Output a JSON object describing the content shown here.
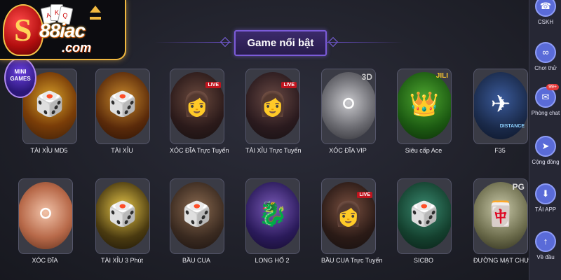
{
  "logo": {
    "brand": "88iac",
    "domain": ".com"
  },
  "mini_games_badge": "MINI GAMES",
  "section": {
    "title": "Game nổi bật"
  },
  "games_row1": [
    {
      "label": "TÀI XỈU MD5",
      "icon": "golden-dice-cup-icon"
    },
    {
      "label": "TÀI XỈU",
      "icon": "dice-icon"
    },
    {
      "label": "XÓC ĐĨA Trực Tuyến",
      "icon": "live-dealer-icon",
      "badge": "LIVE"
    },
    {
      "label": "TÀI XỈU Trực Tuyến",
      "icon": "live-dealer-icon",
      "badge": "LIVE"
    },
    {
      "label": "XÓC ĐĨA VIP",
      "icon": "bowl-plate-icon",
      "badge": "3D"
    },
    {
      "label": "Siêu cấp Ace",
      "icon": "jester-crown-icon",
      "badge": "JILI"
    },
    {
      "label": "F35",
      "icon": "fighter-jet-icon",
      "badge": "DISTANCE"
    }
  ],
  "games_row2": [
    {
      "label": "XÓC ĐĨA",
      "icon": "bowl-plate-icon"
    },
    {
      "label": "TÀI XỈU 3 Phút",
      "icon": "dice-cup-icon"
    },
    {
      "label": "BẦU CUA",
      "icon": "gourd-crab-dice-icon"
    },
    {
      "label": "LONG HỔ 2",
      "icon": "dragon-tiger-icon"
    },
    {
      "label": "BẦU CUA Trực Tuyến",
      "icon": "live-dealer-icon",
      "badge": "LIVE"
    },
    {
      "label": "SICBO",
      "icon": "dice-shaker-icon"
    },
    {
      "label": "ĐƯỜNG MẠT CHƯỢC",
      "icon": "mahjong-tile-icon",
      "badge": "PG"
    }
  ],
  "sidebar": [
    {
      "label": "CSKH",
      "icon": "headset-icon"
    },
    {
      "label": "Chơi thử",
      "icon": "play-trial-icon"
    },
    {
      "label": "Phòng chat",
      "icon": "chat-icon",
      "badge": "99+"
    },
    {
      "label": "Cộng đồng",
      "icon": "telegram-icon"
    },
    {
      "label": "TẢI APP",
      "icon": "download-icon"
    },
    {
      "label": "Về đầu",
      "icon": "arrow-up-icon"
    }
  ],
  "colors": {
    "accent_purple": "#7b5bd8",
    "logo_gold": "#f0b840",
    "sidebar_icon": "#5a6bd8"
  }
}
